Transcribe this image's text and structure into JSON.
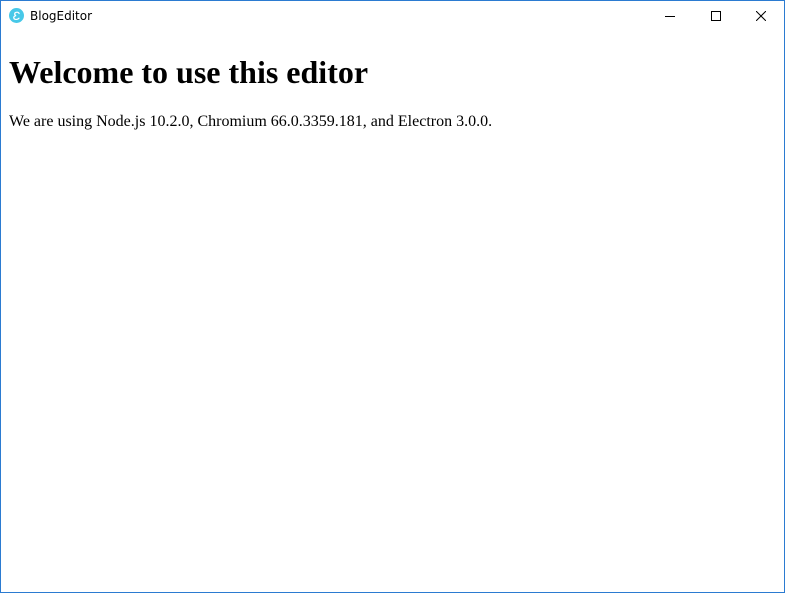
{
  "window": {
    "title": "BlogEditor",
    "icon": "electron-app-icon",
    "controls": {
      "minimize_icon": "minimize-icon",
      "maximize_icon": "maximize-icon",
      "close_icon": "close-icon"
    },
    "border_color": "#2b7bd1",
    "app_icon_color": "#47c8e8"
  },
  "page": {
    "heading": "Welcome to use this editor",
    "paragraph": "We are using Node.js 10.2.0, Chromium 66.0.3359.181, and Electron 3.0.0."
  }
}
